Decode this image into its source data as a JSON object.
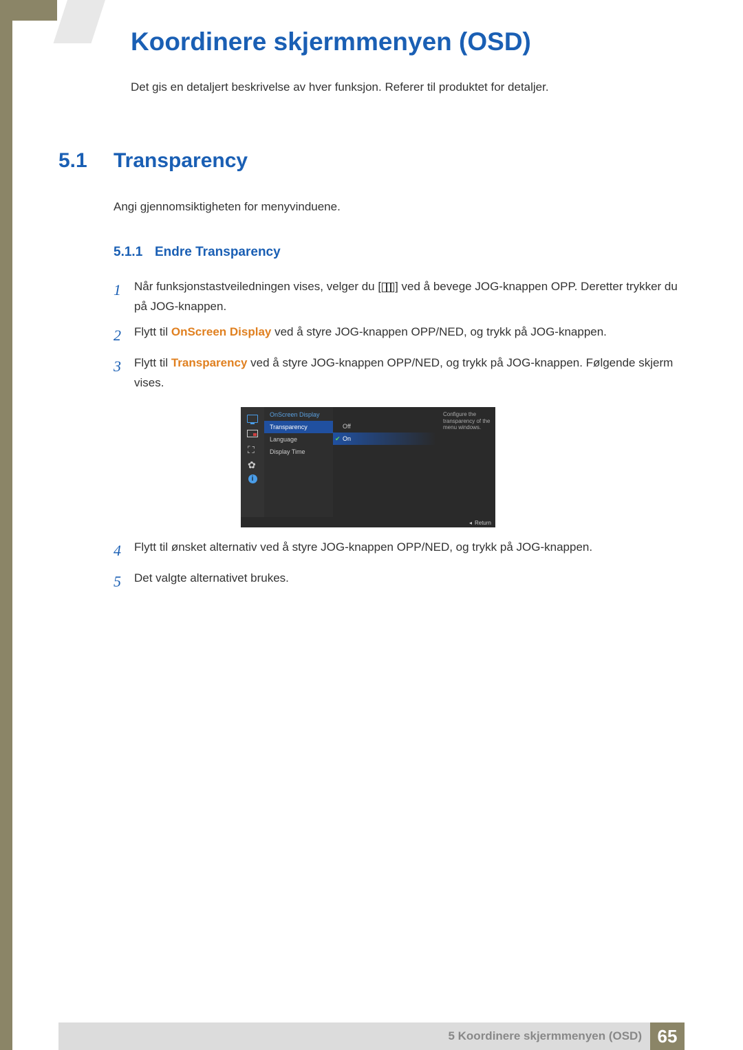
{
  "chapter": {
    "title": "Koordinere skjermmenyen (OSD)",
    "description": "Det gis en detaljert beskrivelse av hver funksjon. Referer til produktet for detaljer."
  },
  "section": {
    "number": "5.1",
    "title": "Transparency",
    "description": "Angi gjennomsiktigheten for menyvinduene."
  },
  "subsection": {
    "number": "5.1.1",
    "title": "Endre Transparency"
  },
  "steps": {
    "s1": {
      "num": "1",
      "pre": "Når funksjonstastveiledningen vises, velger du [",
      "post": "] ved å bevege JOG-knappen OPP. Deretter trykker du på JOG-knappen."
    },
    "s2": {
      "num": "2",
      "pre": "Flytt til ",
      "em": "OnScreen Display",
      "post": " ved å styre JOG-knappen OPP/NED, og trykk på JOG-knappen."
    },
    "s3": {
      "num": "3",
      "pre": "Flytt til ",
      "em": "Transparency",
      "post": " ved å styre JOG-knappen OPP/NED, og trykk på JOG-knappen. Følgende skjerm vises."
    },
    "s4": {
      "num": "4",
      "text": "Flytt til ønsket alternativ ved å styre JOG-knappen OPP/NED, og trykk på JOG-knappen."
    },
    "s5": {
      "num": "5",
      "text": "Det valgte alternativet brukes."
    }
  },
  "osd": {
    "header": "OnScreen Display",
    "items": {
      "transparency": "Transparency",
      "language": "Language",
      "display_time": "Display Time"
    },
    "options": {
      "off": "Off",
      "on": "On"
    },
    "help": "Configure the transparency of the menu windows.",
    "return": "Return",
    "info_char": "i"
  },
  "footer": {
    "text": "5 Koordinere skjermmenyen (OSD)",
    "page": "65"
  }
}
